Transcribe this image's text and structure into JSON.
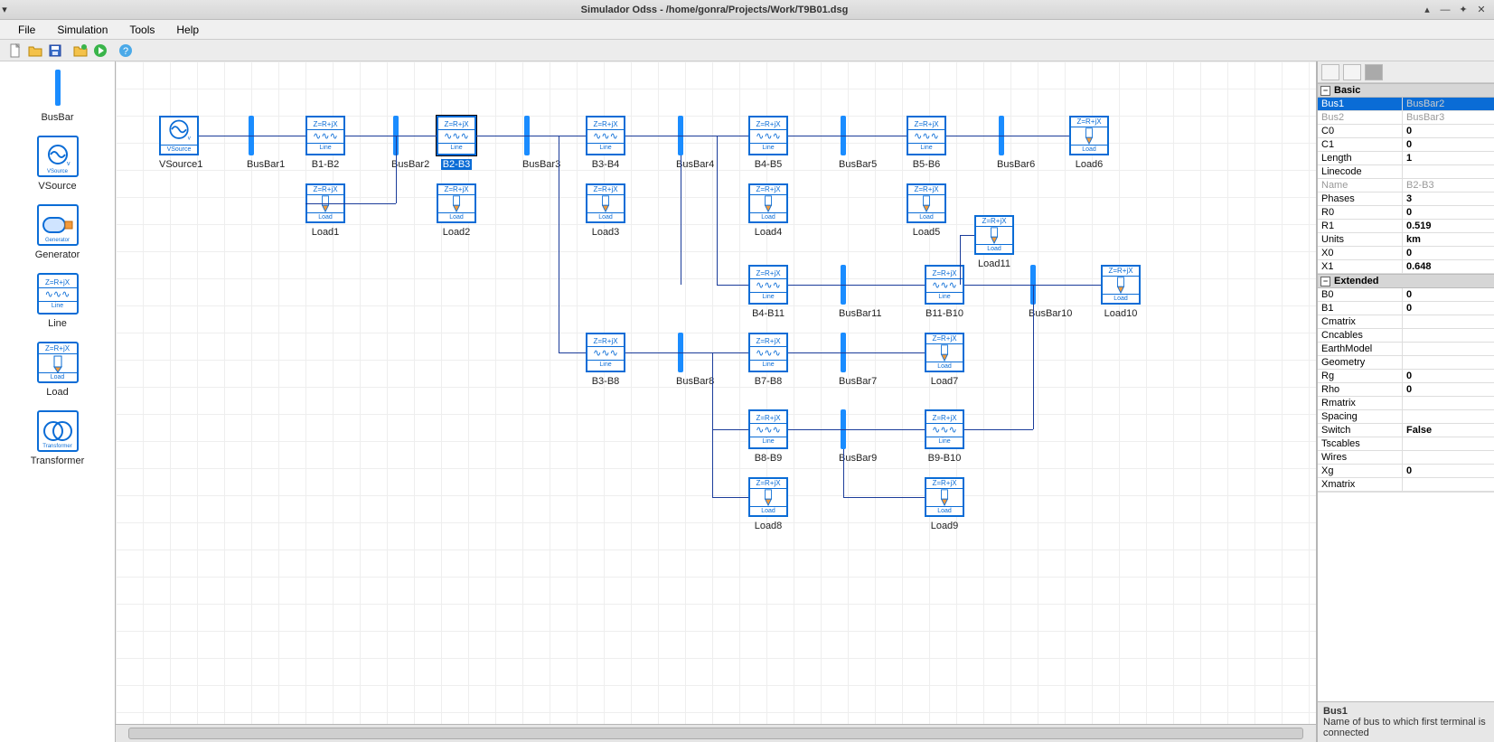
{
  "title": "Simulador Odss - /home/gonra/Projects/Work/T9B01.dsg",
  "menu": {
    "file": "File",
    "simulation": "Simulation",
    "tools": "Tools",
    "help": "Help"
  },
  "palette": {
    "busbar": "BusBar",
    "vsource": "VSource",
    "generator": "Generator",
    "line": "Line",
    "load": "Load",
    "transformer": "Transformer",
    "zlabel": "Z=R+jX",
    "lineword": "Line",
    "loadword": "Load",
    "genword": "Generator",
    "xfmrword": "Transformer",
    "vsourceword": "VSource"
  },
  "canvas": {
    "zlabel": "Z=R+jX",
    "lineword": "Line",
    "loadword": "Load",
    "items": {
      "vsrc1": "VSource1",
      "bus1": "BusBar1",
      "bus2": "BusBar2",
      "bus3": "BusBar3",
      "bus4": "BusBar4",
      "bus5": "BusBar5",
      "bus6": "BusBar6",
      "bus7": "BusBar7",
      "bus8": "BusBar8",
      "bus9": "BusBar9",
      "bus10": "BusBar10",
      "bus11": "BusBar11",
      "l_b1b2": "B1-B2",
      "l_b2b3": "B2-B3",
      "l_b3b4": "B3-B4",
      "l_b4b5": "B4-B5",
      "l_b5b6": "B5-B6",
      "l_b3b8": "B3-B8",
      "l_b7b8": "B7-B8",
      "l_b8b9": "B8-B9",
      "l_b9b10": "B9-B10",
      "l_b4b11": "B4-B11",
      "l_b11b10": "B11-B10",
      "load1": "Load1",
      "load2": "Load2",
      "load3": "Load3",
      "load4": "Load4",
      "load5": "Load5",
      "load6": "Load6",
      "load7": "Load7",
      "load8": "Load8",
      "load9": "Load9",
      "load10": "Load10",
      "load11": "Load11"
    }
  },
  "props": {
    "sections": {
      "basic": "Basic",
      "extended": "Extended"
    },
    "basic": [
      {
        "k": "Bus1",
        "v": "BusBar2",
        "selected": true,
        "disabledVal": true
      },
      {
        "k": "Bus2",
        "v": "BusBar3",
        "disabled": true
      },
      {
        "k": "C0",
        "v": "0",
        "bold": true
      },
      {
        "k": "C1",
        "v": "0",
        "bold": true
      },
      {
        "k": "Length",
        "v": "1",
        "bold": true
      },
      {
        "k": "Linecode",
        "v": ""
      },
      {
        "k": "Name",
        "v": "B2-B3",
        "disabled": true
      },
      {
        "k": "Phases",
        "v": "3",
        "bold": true
      },
      {
        "k": "R0",
        "v": "0",
        "bold": true
      },
      {
        "k": "R1",
        "v": "0.519",
        "bold": true
      },
      {
        "k": "Units",
        "v": "km",
        "bold": true
      },
      {
        "k": "X0",
        "v": "0",
        "bold": true
      },
      {
        "k": "X1",
        "v": "0.648",
        "bold": true
      }
    ],
    "extended": [
      {
        "k": "B0",
        "v": "0",
        "bold": true
      },
      {
        "k": "B1",
        "v": "0",
        "bold": true
      },
      {
        "k": "Cmatrix",
        "v": ""
      },
      {
        "k": "Cncables",
        "v": ""
      },
      {
        "k": "EarthModel",
        "v": ""
      },
      {
        "k": "Geometry",
        "v": ""
      },
      {
        "k": "Rg",
        "v": "0",
        "bold": true
      },
      {
        "k": "Rho",
        "v": "0",
        "bold": true
      },
      {
        "k": "Rmatrix",
        "v": ""
      },
      {
        "k": "Spacing",
        "v": ""
      },
      {
        "k": "Switch",
        "v": "False",
        "bold": true
      },
      {
        "k": "Tscables",
        "v": ""
      },
      {
        "k": "Wires",
        "v": ""
      },
      {
        "k": "Xg",
        "v": "0",
        "bold": true
      },
      {
        "k": "Xmatrix",
        "v": ""
      }
    ],
    "help": {
      "title": "Bus1",
      "text": "Name of bus to which first terminal is connected"
    }
  }
}
